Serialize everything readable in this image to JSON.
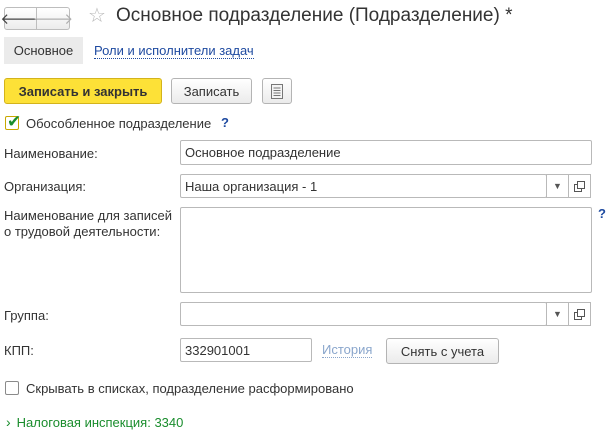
{
  "window": {
    "title": "Основное подразделение (Подразделение) *",
    "back_glyph": "🡐",
    "forward_glyph": "🡒",
    "star_glyph": "☆"
  },
  "tabs": [
    {
      "label": "Основное",
      "active": true
    },
    {
      "label": "Роли и исполнители задач",
      "active": false
    }
  ],
  "toolbar": {
    "save_and_close_label": "Записать и закрыть",
    "save_label": "Записать",
    "more_icon": "document-list-icon"
  },
  "form": {
    "separate_division": {
      "label": "Обособленное подразделение",
      "checked": true,
      "help": "?"
    },
    "name": {
      "label": "Наименование:",
      "value": "Основное подразделение"
    },
    "organization": {
      "label": "Организация:",
      "value": "Наша организация - 1"
    },
    "labor_name": {
      "label_line1": "Наименование для записей",
      "label_line2": "о трудовой деятельности:",
      "value": "",
      "help": "?"
    },
    "group": {
      "label": "Группа:",
      "value": ""
    },
    "kpp": {
      "label": "КПП:",
      "value": "332901001",
      "history_label": "История",
      "deregister_label": "Снять с учета"
    },
    "hide_in_lists": {
      "label": "Скрывать в списках, подразделение расформировано",
      "checked": false
    },
    "tax_inspection": {
      "label": "Налоговая инспекция: 3340",
      "expanded": false
    }
  },
  "colors": {
    "accent_yellow": "#fde137",
    "link_blue": "#1e4aa0",
    "green": "#1a8d2d"
  }
}
